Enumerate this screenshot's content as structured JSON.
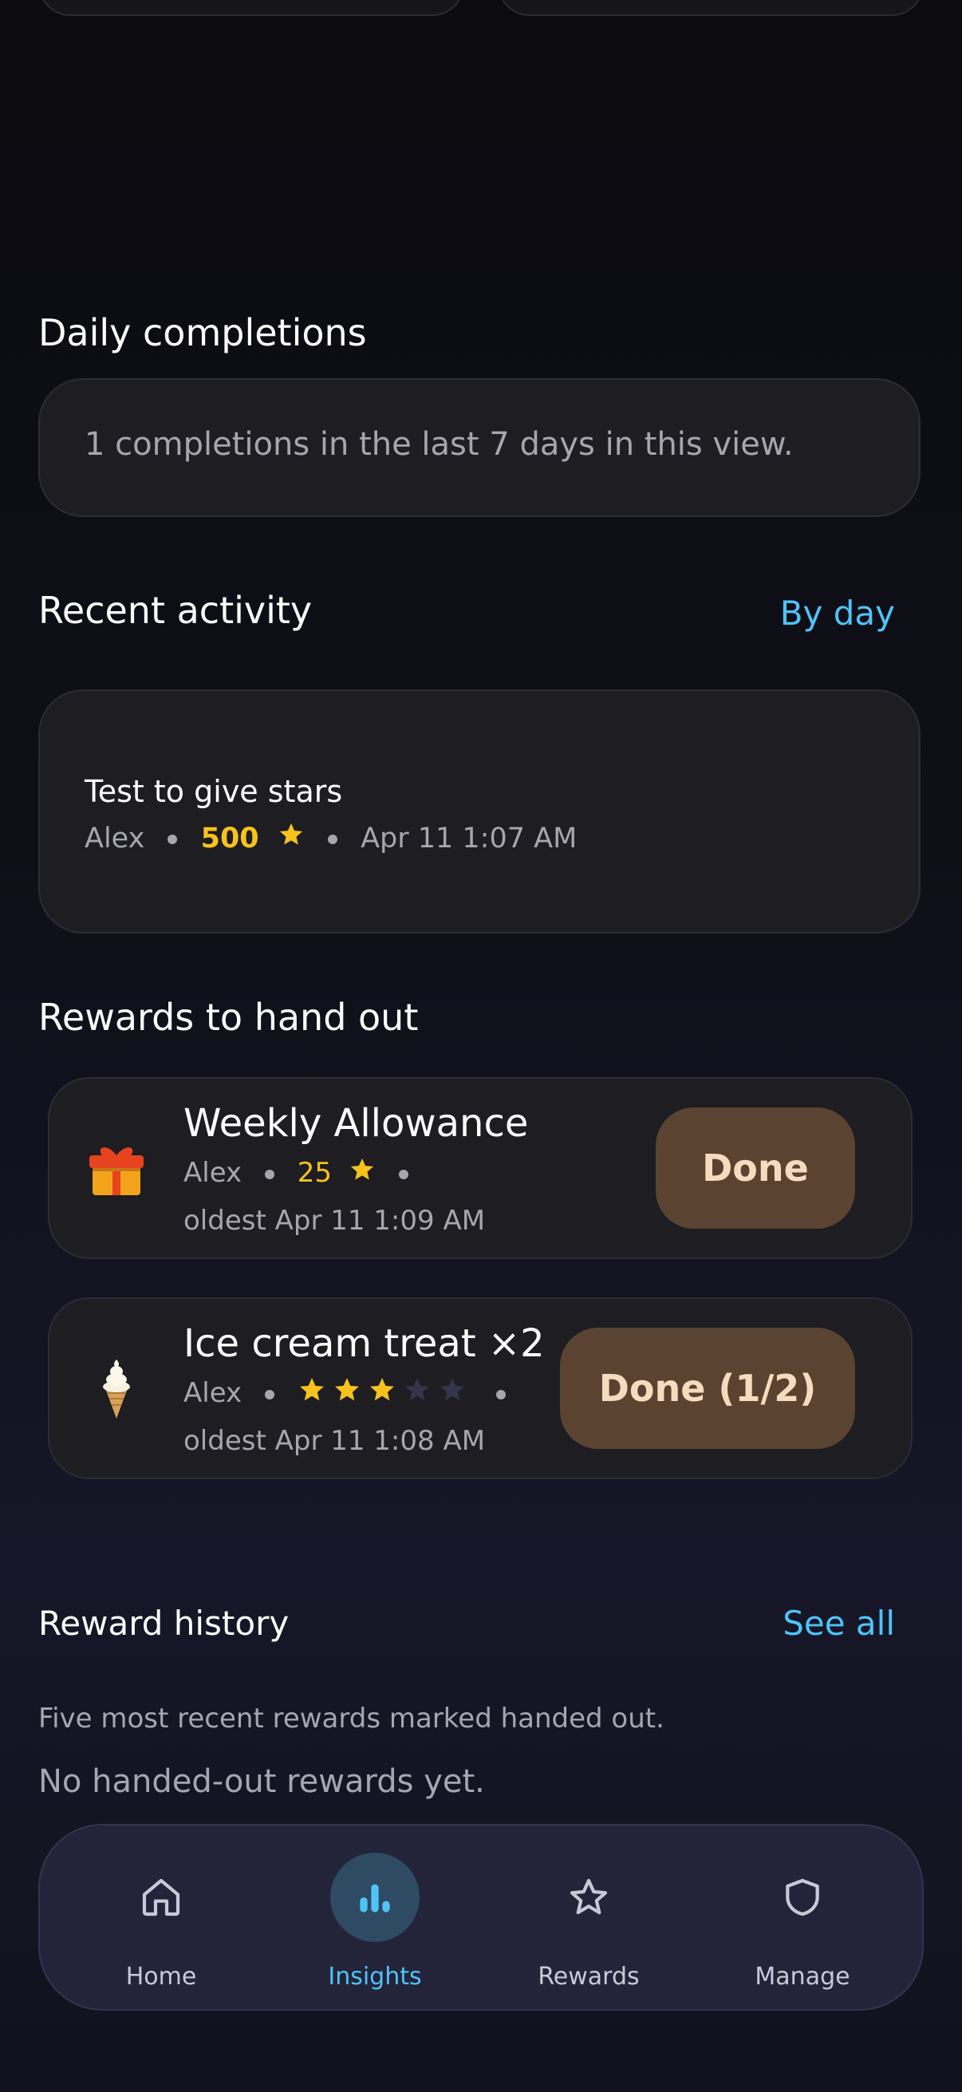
{
  "daily": {
    "title": "Daily completions",
    "summary": "1 completions in the last 7 days in this view."
  },
  "recent": {
    "title": "Recent activity",
    "link": "By day",
    "item": {
      "title": "Test to give stars",
      "person": "Alex",
      "stars": "500",
      "time": "Apr 11 1:07 AM"
    }
  },
  "rewards": {
    "title": "Rewards to hand out",
    "items": [
      {
        "emoji": "gift-icon",
        "title": "Weekly Allowance",
        "person": "Alex",
        "stars": "25",
        "oldest": "oldest Apr 11 1:09 AM",
        "button": "Done"
      },
      {
        "emoji": "ice-cream-icon",
        "title": "Ice cream treat ×2",
        "person": "Alex",
        "rating": 3,
        "rating_max": 5,
        "oldest": "oldest Apr 11 1:08 AM",
        "button": "Done (1/2)"
      }
    ]
  },
  "history": {
    "title": "Reward history",
    "link": "See all",
    "subtitle": "Five most recent rewards marked handed out.",
    "empty": "No handed-out rewards yet."
  },
  "nav": {
    "items": [
      {
        "label": "Home",
        "icon": "home-icon",
        "active": false
      },
      {
        "label": "Insights",
        "icon": "bar-chart-icon",
        "active": true
      },
      {
        "label": "Rewards",
        "icon": "star-icon",
        "active": false
      },
      {
        "label": "Manage",
        "icon": "shield-icon",
        "active": false
      }
    ]
  },
  "colors": {
    "accent": "#4fc3f7",
    "star": "#f7c21b",
    "button_bg": "#5a4330",
    "button_text": "#f6dcbf"
  }
}
